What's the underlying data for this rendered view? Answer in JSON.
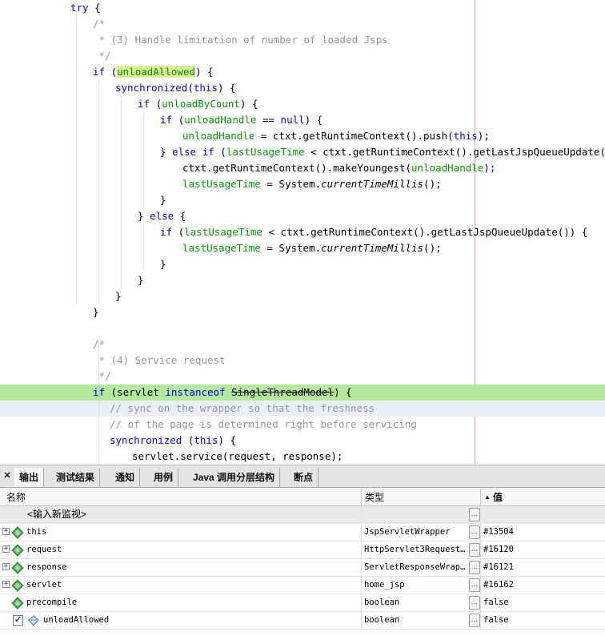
{
  "editor": {
    "lines": [
      {
        "tokens": [
          {
            "t": "try",
            "c": "kw"
          },
          {
            "t": " {"
          }
        ]
      },
      {
        "tokens": [
          {
            "t": "/*",
            "c": "cm"
          }
        ]
      },
      {
        "tokens": [
          {
            "t": " * (3) Handle limitation of number of loaded Jsps",
            "c": "cm"
          }
        ]
      },
      {
        "tokens": [
          {
            "t": " */",
            "c": "cm"
          }
        ]
      },
      {
        "tokens": [
          {
            "t": "if",
            "c": "kw"
          },
          {
            "t": " ("
          },
          {
            "t": "unloadAllowed",
            "c": "id mark"
          },
          {
            "t": ") {"
          }
        ]
      },
      {
        "tokens": [
          {
            "t": "synchronized",
            "c": "kw"
          },
          {
            "t": "("
          },
          {
            "t": "this",
            "c": "kw"
          },
          {
            "t": ") {"
          }
        ]
      },
      {
        "tokens": [
          {
            "t": "if",
            "c": "kw"
          },
          {
            "t": " ("
          },
          {
            "t": "unloadByCount",
            "c": "id"
          },
          {
            "t": ") {"
          }
        ]
      },
      {
        "tokens": [
          {
            "t": "if",
            "c": "kw"
          },
          {
            "t": " ("
          },
          {
            "t": "unloadHandle",
            "c": "id"
          },
          {
            "t": " == "
          },
          {
            "t": "null",
            "c": "kw"
          },
          {
            "t": ") {"
          }
        ]
      },
      {
        "tokens": [
          {
            "t": "unloadHandle",
            "c": "id"
          },
          {
            "t": " = ctxt.getRuntimeContext().push("
          },
          {
            "t": "this",
            "c": "kw"
          },
          {
            "t": ");"
          }
        ]
      },
      {
        "tokens": [
          {
            "t": "} "
          },
          {
            "t": "else if",
            "c": "kw"
          },
          {
            "t": " ("
          },
          {
            "t": "lastUsageTime",
            "c": "id"
          },
          {
            "t": " < ctxt.getRuntimeContext().getLastJspQueueUpdate()) {"
          }
        ]
      },
      {
        "tokens": [
          {
            "t": "ctxt.getRuntimeContext().makeYoungest("
          },
          {
            "t": "unloadHandle",
            "c": "id"
          },
          {
            "t": ");"
          }
        ]
      },
      {
        "tokens": [
          {
            "t": "lastUsageTime",
            "c": "id"
          },
          {
            "t": " = System."
          },
          {
            "t": "currentTimeMillis",
            "c": "it"
          },
          {
            "t": "();"
          }
        ]
      },
      {
        "tokens": [
          {
            "t": "}"
          }
        ]
      },
      {
        "tokens": [
          {
            "t": "} "
          },
          {
            "t": "else",
            "c": "kw"
          },
          {
            "t": " {"
          }
        ]
      },
      {
        "tokens": [
          {
            "t": "if",
            "c": "kw"
          },
          {
            "t": " ("
          },
          {
            "t": "lastUsageTime",
            "c": "id"
          },
          {
            "t": " < ctxt.getRuntimeContext().getLastJspQueueUpdate()) {"
          }
        ]
      },
      {
        "tokens": [
          {
            "t": "lastUsageTime",
            "c": "id"
          },
          {
            "t": " = System."
          },
          {
            "t": "currentTimeMillis",
            "c": "it"
          },
          {
            "t": "();"
          }
        ]
      },
      {
        "tokens": [
          {
            "t": "}"
          }
        ]
      },
      {
        "tokens": [
          {
            "t": "}"
          }
        ]
      },
      {
        "tokens": [
          {
            "t": "}"
          }
        ]
      },
      {
        "tokens": [
          {
            "t": "}"
          }
        ]
      },
      {
        "tokens": []
      },
      {
        "tokens": [
          {
            "t": "/*",
            "c": "cm"
          }
        ]
      },
      {
        "tokens": [
          {
            "t": " * (4) Service request",
            "c": "cm"
          }
        ]
      },
      {
        "tokens": [
          {
            "t": " */",
            "c": "cm"
          }
        ]
      },
      {
        "tokens": [
          {
            "t": "if",
            "c": "kw"
          },
          {
            "t": " (servlet "
          },
          {
            "t": "instanceof",
            "c": "kw"
          },
          {
            "t": " "
          },
          {
            "t": "SingleThreadModel",
            "c": "strike"
          },
          {
            "t": ") {"
          }
        ]
      },
      {
        "tokens": [
          {
            "t": "// sync on the wrapper so that the freshness",
            "c": "cm"
          }
        ]
      },
      {
        "tokens": [
          {
            "t": "// of the page is determined right before servicing",
            "c": "cm"
          }
        ]
      },
      {
        "tokens": [
          {
            "t": "synchronized",
            "c": "kw"
          },
          {
            "t": " ("
          },
          {
            "t": "this",
            "c": "kw"
          },
          {
            "t": ") {"
          }
        ]
      },
      {
        "tokens": [
          {
            "t": "servlet.service(request, response);"
          }
        ]
      }
    ]
  },
  "panel": {
    "tabs": [
      "输出",
      "测试结果",
      "通知",
      "用例",
      "Java 调用分层结构",
      "断点"
    ],
    "columns": {
      "name": "名称",
      "type": "类型",
      "value": "值"
    },
    "new_watch": "<输入新监视>",
    "rows": [
      {
        "name": "this",
        "type": "JspServletWrapper",
        "value": "#13504",
        "icon": "field-icon",
        "expandable": true,
        "checkbox": false
      },
      {
        "name": "request",
        "type": "HttpServlet3Request…",
        "value": "#16120",
        "icon": "field-icon",
        "expandable": true,
        "checkbox": false
      },
      {
        "name": "response",
        "type": "ServletResponseWrap…",
        "value": "#16121",
        "icon": "field-icon",
        "expandable": true,
        "checkbox": false
      },
      {
        "name": "servlet",
        "type": "home_jsp",
        "value": "#16162",
        "icon": "field-icon",
        "expandable": true,
        "checkbox": false
      },
      {
        "name": "precompile",
        "type": "boolean",
        "value": "false",
        "icon": "field-icon",
        "expandable": false,
        "checkbox": false
      },
      {
        "name": "unloadAllowed",
        "type": "boolean",
        "value": "false",
        "icon": "watch-icon",
        "expandable": false,
        "checkbox": true
      }
    ]
  }
}
